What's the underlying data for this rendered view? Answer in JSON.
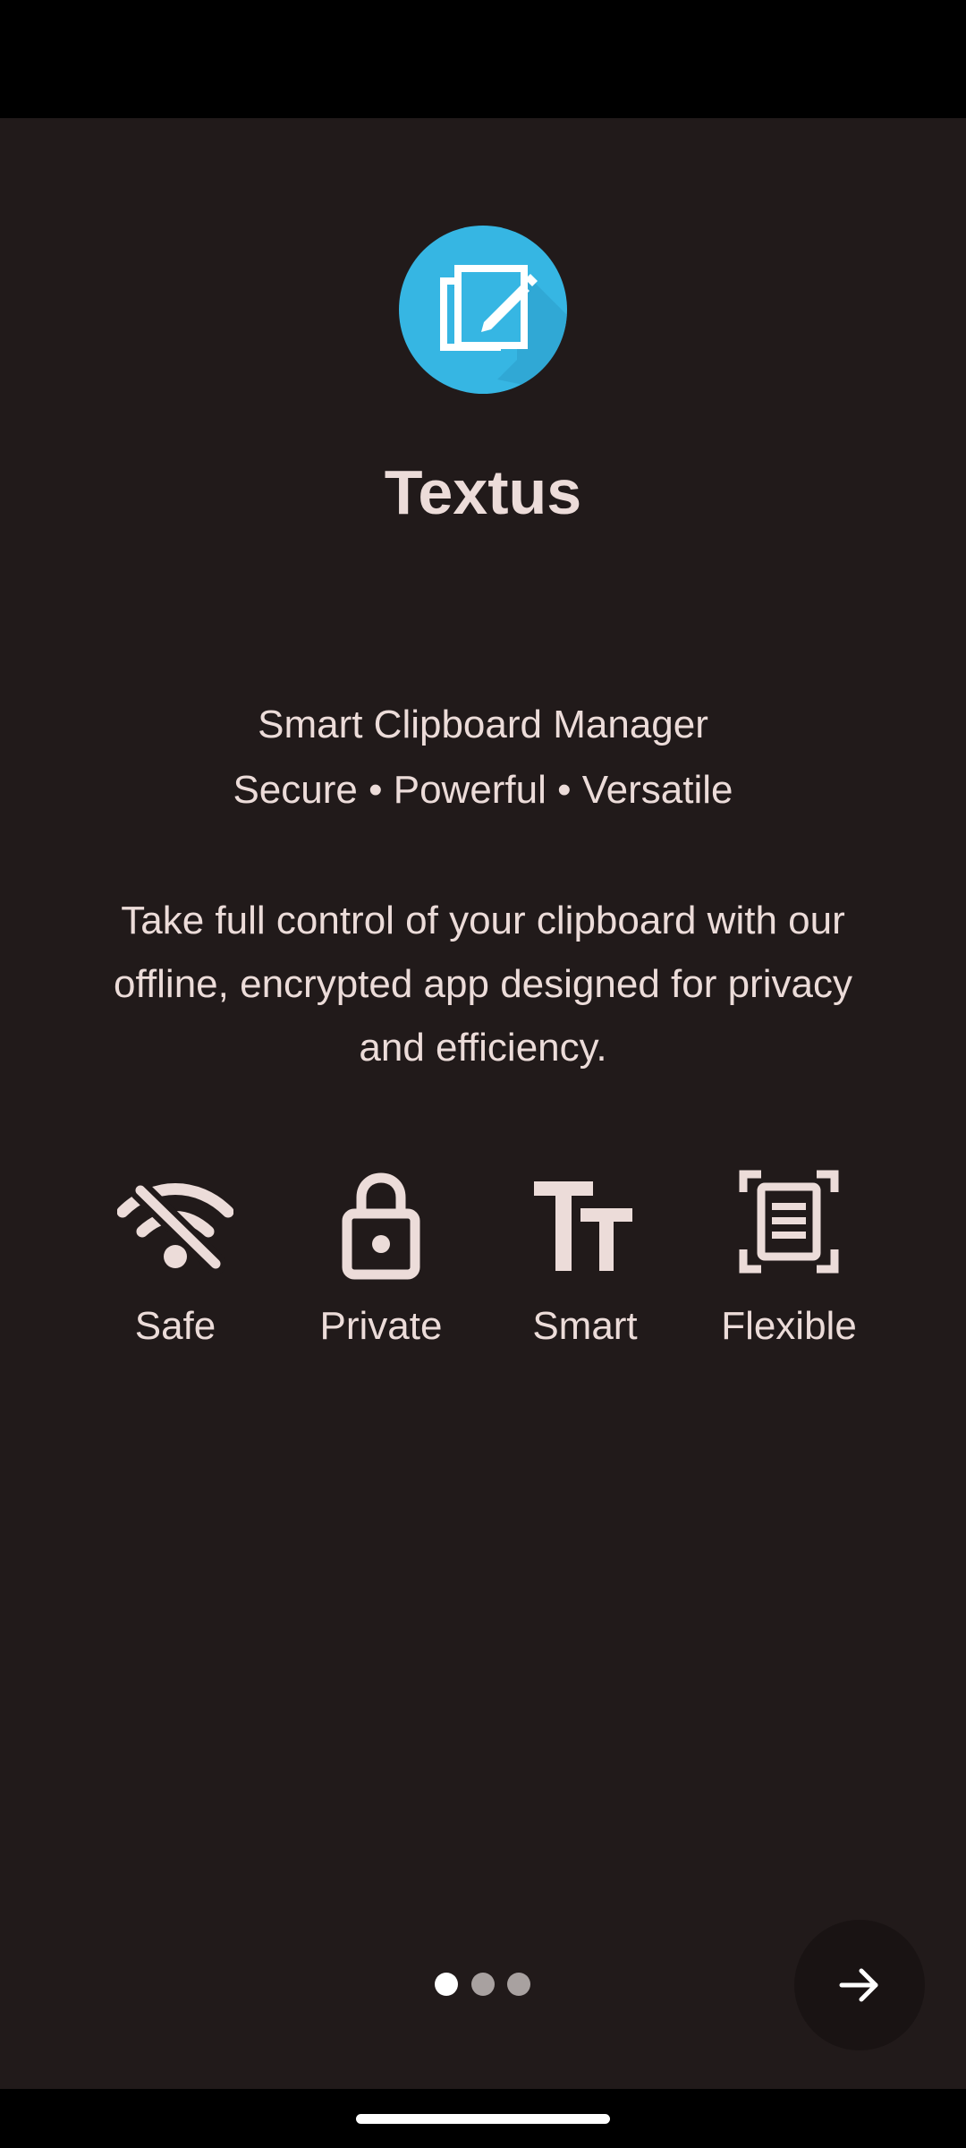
{
  "app": {
    "name": "Textus",
    "logo_icon": "clipboard-edit-icon",
    "logo_color": "#36b6e3"
  },
  "tagline": {
    "line1": "Smart Clipboard Manager",
    "line2": "Secure • Powerful • Versatile"
  },
  "description": "Take full control of your clipboard with our offline, encrypted app designed for privacy and efficiency.",
  "features": [
    {
      "label": "Safe",
      "icon": "wifi-off-icon"
    },
    {
      "label": "Private",
      "icon": "lock-icon"
    },
    {
      "label": "Smart",
      "icon": "text-size-icon"
    },
    {
      "label": "Flexible",
      "icon": "document-scan-icon"
    }
  ],
  "pager": {
    "total": 3,
    "current": 1
  },
  "next_button": {
    "icon": "arrow-right-icon"
  },
  "colors": {
    "background": "#211a1a",
    "text": "#ecdcd9",
    "accent": "#36b6e3",
    "dot_active": "#ffffff",
    "dot_inactive": "#a8a1a0"
  }
}
